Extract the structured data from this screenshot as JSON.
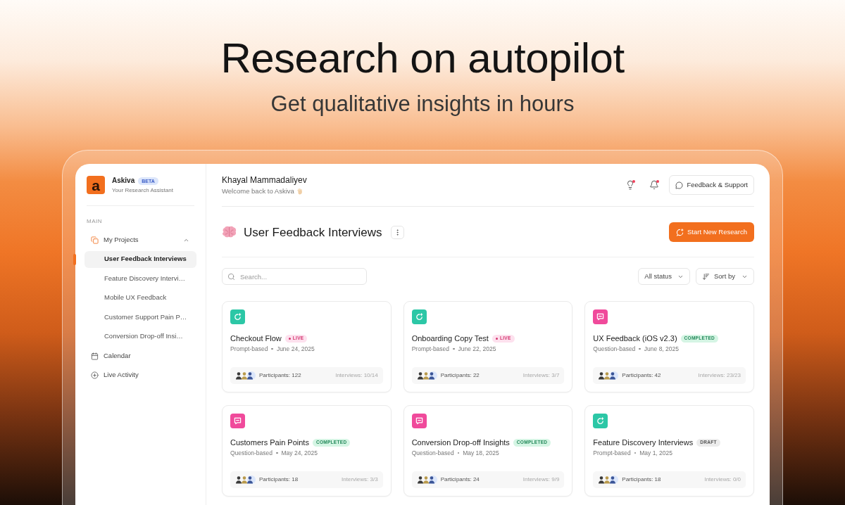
{
  "hero": {
    "title": "Research on autopilot",
    "subtitle": "Get qualitative insights in hours"
  },
  "sidebar": {
    "logo": "a",
    "app_name": "Askiva",
    "badge": "BETA",
    "tagline": "Your Research Assistant",
    "section": "MAIN",
    "items": [
      {
        "kind": "projects",
        "label": "My Projects",
        "expanded": true,
        "children": [
          {
            "label": "User Feedback Interviews",
            "selected": true
          },
          {
            "label": "Feature Discovery Intervi…",
            "selected": false
          },
          {
            "label": "Mobile UX Feedback",
            "selected": false
          },
          {
            "label": "Customer Support Pain P…",
            "selected": false
          },
          {
            "label": "Conversion Drop-off Insi…",
            "selected": false
          }
        ]
      },
      {
        "kind": "calendar",
        "label": "Calendar"
      },
      {
        "kind": "activity",
        "label": "Live Activity"
      }
    ]
  },
  "header": {
    "user_name": "Khayal Mammadaliyev",
    "greeting": "Welcome back to Askiva",
    "icon_buttons": [
      {
        "kind": "tips",
        "unread": true
      },
      {
        "kind": "notifications",
        "unread": true
      }
    ],
    "support_button": "Feedback & Support"
  },
  "project": {
    "title": "User Feedback Interviews",
    "action_button": "Start New Research"
  },
  "toolbar": {
    "search": {
      "placeholder": "Search..."
    },
    "status_filter": "All status",
    "sort": "Sort by"
  },
  "cards": [
    {
      "kind": "prompt",
      "title": "Checkout Flow",
      "badge": {
        "kind": "live",
        "label": "LIVE"
      },
      "method": "Prompt-based",
      "date": "June 24, 2025",
      "participants": "Participants: 122",
      "interviews": "Interviews: 10/14"
    },
    {
      "kind": "prompt",
      "title": "Onboarding Copy Test",
      "badge": {
        "kind": "live",
        "label": "LIVE"
      },
      "method": "Prompt-based",
      "date": "June 22, 2025",
      "participants": "Participants: 22",
      "interviews": "Interviews: 3/7"
    },
    {
      "kind": "question",
      "title": "UX Feedback (iOS v2.3)",
      "badge": {
        "kind": "completed",
        "label": "COMPLETED"
      },
      "method": "Question-based",
      "date": "June 8, 2025",
      "participants": "Participants: 42",
      "interviews": "Interviews: 23/23"
    },
    {
      "kind": "question",
      "title": "Customers Pain Points",
      "badge": {
        "kind": "completed",
        "label": "COMPLETED"
      },
      "method": "Question-based",
      "date": "May 24, 2025",
      "participants": "Participants: 18",
      "interviews": "Interviews: 3/3"
    },
    {
      "kind": "question",
      "title": "Conversion Drop-off Insights",
      "badge": {
        "kind": "completed",
        "label": "COMPLETED"
      },
      "method": "Question-based",
      "date": "May 18, 2025",
      "participants": "Participants: 24",
      "interviews": "Interviews: 9/9"
    },
    {
      "kind": "prompt",
      "title": "Feature Discovery Interviews",
      "badge": {
        "kind": "draft",
        "label": "DRAFT"
      },
      "method": "Prompt-based",
      "date": "May 1, 2025",
      "participants": "Participants: 18",
      "interviews": "Interviews: 0/0"
    }
  ]
}
